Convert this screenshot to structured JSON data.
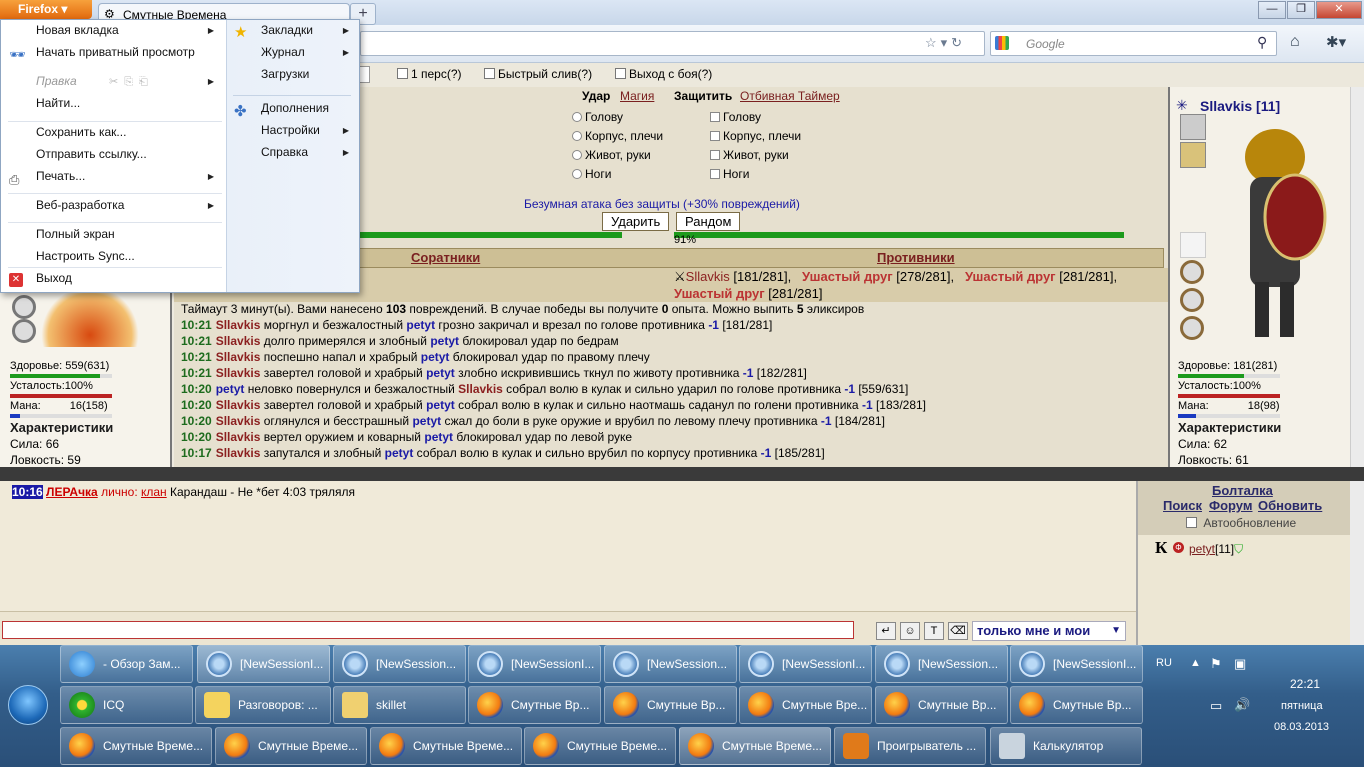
{
  "browser": {
    "menu_button": "Firefox",
    "tab_title": "Смутные Времена",
    "new_tab": "+",
    "search_placeholder": "Google"
  },
  "ff_menu": {
    "left": [
      {
        "label": "Новая вкладка",
        "arrow": true
      },
      {
        "label": "Начать приватный просмотр"
      },
      {
        "label": "Правка",
        "arrow": true,
        "disabled": true
      },
      {
        "label": "Найти..."
      },
      {
        "label": "Сохранить как..."
      },
      {
        "label": "Отправить ссылку..."
      },
      {
        "label": "Печать...",
        "arrow": true
      },
      {
        "label": "Веб-разработка",
        "arrow": true
      },
      {
        "label": "Полный экран"
      },
      {
        "label": "Настроить Sync..."
      },
      {
        "label": "Выход"
      }
    ],
    "right": [
      {
        "label": "Закладки",
        "arrow": true
      },
      {
        "label": "Журнал",
        "arrow": true
      },
      {
        "label": "Загрузки"
      },
      {
        "label": "Дополнения"
      },
      {
        "label": "Настройки",
        "arrow": true
      },
      {
        "label": "Справка",
        "arrow": true
      }
    ]
  },
  "game": {
    "options": [
      "1 перс(?)",
      "Быстрый слив(?)",
      "Выход с боя(?)"
    ],
    "attack_label": "Удар",
    "magic_link": "Магия",
    "defend_label": "Защитить",
    "timer_link": "Отбивная Таймер",
    "zones": [
      "Голову",
      "Корпус, плечи",
      "Живот, руки",
      "Ноги"
    ],
    "crazy_attack": "Безумная атака без защиты (+30% повреждений)",
    "hit_button": "Ударить",
    "random_button": "Рандом",
    "percent": "91%",
    "allies_header": "Соратники",
    "enemies_header": "Противники",
    "fighters": [
      {
        "name": "Sllavkis",
        "hp": "[181/281],"
      },
      {
        "name": "Ушастый друг",
        "hp": "[278/281],"
      },
      {
        "name": "Ушастый друг",
        "hp": "[281/281],"
      },
      {
        "name": "Ушастый друг",
        "hp": "[281/281]"
      }
    ],
    "summary": {
      "a": "Таймаут 3 минут(ы). Вами нанесено ",
      "dmg": "103",
      "b": " повреждений. В случае победы вы получите ",
      "exp": "0",
      "c": " опыта. Можно выпить ",
      "elix": "5",
      "d": " эликсиров"
    },
    "log": [
      {
        "time": "10:21",
        "a": "Sllavkis",
        "mid": " моргнул и безжалостный ",
        "b": "petyt",
        "rest": " грозно закричал и врезал по голове противника ",
        "dmg": "-1",
        "hp": " [181/281]"
      },
      {
        "time": "10:21",
        "a": "Sllavkis",
        "mid": " долго примерялся и злобный ",
        "b": "petyt",
        "rest": " блокировал удар по бедрам",
        "dmg": "",
        "hp": ""
      },
      {
        "time": "10:21",
        "a": "Sllavkis",
        "mid": " поспешно напал и храбрый ",
        "b": "petyt",
        "rest": " блокировал удар по правому плечу",
        "dmg": "",
        "hp": ""
      },
      {
        "time": "10:21",
        "a": "Sllavkis",
        "mid": " завертел головой и храбрый ",
        "b": "petyt",
        "rest": " злобно искривившись ткнул по животу противника ",
        "dmg": "-1",
        "hp": " [182/281]"
      },
      {
        "time": "10:20",
        "a": "petyt",
        "mid": " неловко повернулся и безжалостный ",
        "b": "Sllavkis",
        "rest": " собрал волю в кулак и сильно ударил по голове противника ",
        "dmg": "-1",
        "hp": " [559/631]"
      },
      {
        "time": "10:20",
        "a": "Sllavkis",
        "mid": " завертел головой и храбрый ",
        "b": "petyt",
        "rest": " собрал волю в кулак и сильно наотмашь саданул по голени противника ",
        "dmg": "-1",
        "hp": " [183/281]"
      },
      {
        "time": "10:20",
        "a": "Sllavkis",
        "mid": " оглянулся и бесстрашный ",
        "b": "petyt",
        "rest": " сжал до боли в руке оружие и врубил по левому плечу противника ",
        "dmg": "-1",
        "hp": " [184/281]"
      },
      {
        "time": "10:20",
        "a": "Sllavkis",
        "mid": " вертел оружием и коварный ",
        "b": "petyt",
        "rest": " блокировал удар по левой руке",
        "dmg": "",
        "hp": ""
      },
      {
        "time": "10:17",
        "a": "Sllavkis",
        "mid": " запутался и злобный ",
        "b": "petyt",
        "rest": " собрал волю в кулак и сильно врубил по корпусу противника ",
        "dmg": "-1",
        "hp": " [185/281]"
      }
    ],
    "left_stats": {
      "health_label": "Здоровье:",
      "health_val": "559(631)",
      "health_frac": 0.886,
      "fatigue_label": "Усталость:",
      "fatigue_val": "100%",
      "mana_label": "Мана:",
      "mana_val": "16(158)",
      "mana_frac": 0.1,
      "chars_title": "Характеристики",
      "str_label": "Сила:",
      "str_val": "66",
      "agi_label": "Ловкость:",
      "agi_val": "59"
    },
    "right_player": {
      "name": "Sllavkis",
      "level": "[11]",
      "health_label": "Здоровье:",
      "health_val": "181(281)",
      "health_frac": 0.644,
      "fatigue_label": "Усталость:",
      "fatigue_val": "100%",
      "mana_label": "Мана:",
      "mana_val": "18(98)",
      "mana_frac": 0.18,
      "chars_title": "Характеристики",
      "str_label": "Сила:",
      "str_val": "62",
      "agi_label": "Ловкость:",
      "agi_val": "61"
    }
  },
  "chat": {
    "time": "10:16",
    "from": "ЛЕРАчка",
    "private": " лично: ",
    "clan": "клан",
    "text": " Карандаш - Не *бет 4:03 тряляля",
    "filter": "только мне и мои",
    "right_title": "Болталка",
    "search": "Поиск",
    "forum": "Форум",
    "refresh": "Обновить",
    "auto": "Автообновление",
    "online_letter": "К",
    "online_user": "petyt",
    "online_level": "[11]"
  },
  "taskbar": {
    "row1": [
      "- Обзор Зам...",
      "[NewSessionI...",
      "[NewSession...",
      "[NewSessionI...",
      "[NewSession...",
      "[NewSessionI...",
      "[NewSession...",
      "[NewSessionI..."
    ],
    "row2": [
      "ICQ",
      "Разговоров: ...",
      "skillet",
      "Смутные Вр...",
      "Смутные Вр...",
      "Смутные Вре...",
      "Смутные Вр...",
      "Смутные Вр..."
    ],
    "row3": [
      "Смутные Време...",
      "Смутные Време...",
      "Смутные Време...",
      "Смутные Време...",
      "Смутные Време...",
      "Проигрыватель ...",
      "Калькулятор"
    ],
    "lang": "RU",
    "time": "22:21",
    "day": "пятница",
    "date": "08.03.2013"
  }
}
